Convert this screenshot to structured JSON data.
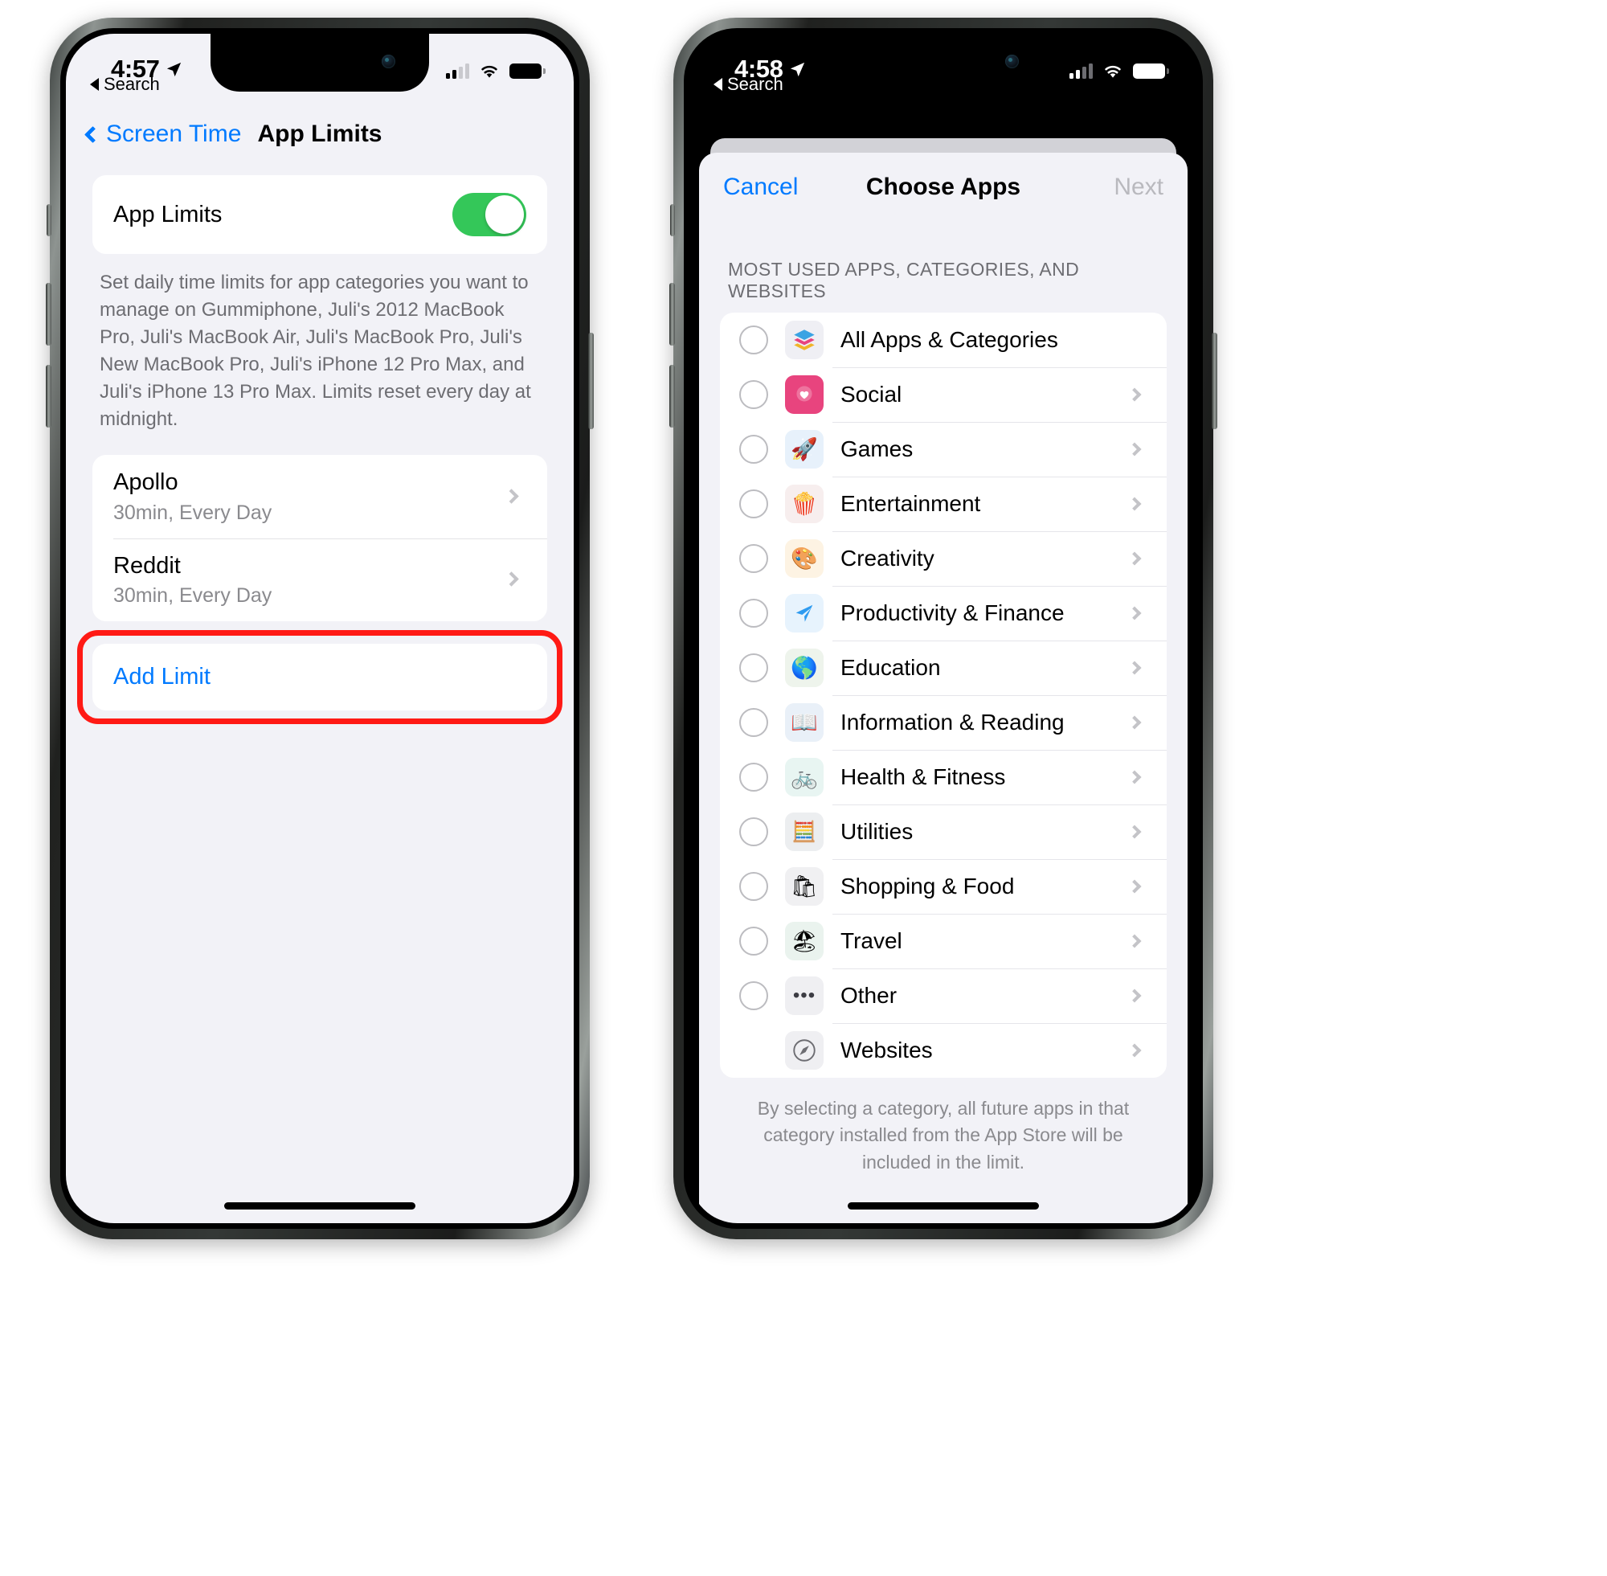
{
  "left_phone": {
    "status": {
      "time": "4:57",
      "location_icon": "location-arrow-icon",
      "signal_icon": "cellular-bars-icon",
      "wifi_icon": "wifi-icon",
      "battery_icon": "battery-full-icon"
    },
    "back_to_app": "Search",
    "nav": {
      "back_label": "Screen Time",
      "title": "App Limits"
    },
    "toggle_row": {
      "label": "App Limits",
      "state": "on",
      "accent_color": "#34c759"
    },
    "footnote": "Set daily time limits for app categories you want to manage on Gummiphone, Juli's 2012 MacBook Pro, Juli's MacBook Air, Juli's MacBook Pro, Juli's New MacBook Pro, Juli's iPhone 12 Pro Max, and Juli's iPhone 13 Pro Max. Limits reset every day at midnight.",
    "limits": [
      {
        "name": "Apollo",
        "detail": "30min, Every Day"
      },
      {
        "name": "Reddit",
        "detail": "30min, Every Day"
      }
    ],
    "add_limit": {
      "label": "Add Limit",
      "highlight_color": "#ff1a15",
      "text_color": "#007aff"
    }
  },
  "right_phone": {
    "status": {
      "time": "4:58",
      "location_icon": "location-arrow-icon",
      "signal_icon": "cellular-bars-icon",
      "wifi_icon": "wifi-icon",
      "battery_icon": "battery-full-icon"
    },
    "back_to_app": "Search",
    "sheet": {
      "cancel": "Cancel",
      "title": "Choose Apps",
      "next": "Next",
      "section_header": "MOST USED APPS, CATEGORIES, AND WEBSITES",
      "options": [
        {
          "label": "All Apps & Categories",
          "icon": "layers-icon",
          "glyph": "☰",
          "selected": false,
          "has_chevron": false,
          "has_radio": true
        },
        {
          "label": "Social",
          "icon": "social-heart-icon",
          "glyph": "♥",
          "selected": false,
          "has_chevron": true,
          "has_radio": true
        },
        {
          "label": "Games",
          "icon": "rocket-icon",
          "glyph": "🚀",
          "selected": false,
          "has_chevron": true,
          "has_radio": true
        },
        {
          "label": "Entertainment",
          "icon": "popcorn-icon",
          "glyph": "🍿",
          "selected": false,
          "has_chevron": true,
          "has_radio": true
        },
        {
          "label": "Creativity",
          "icon": "palette-icon",
          "glyph": "🎨",
          "selected": false,
          "has_chevron": true,
          "has_radio": true
        },
        {
          "label": "Productivity & Finance",
          "icon": "paper-plane-icon",
          "glyph": "➤",
          "selected": false,
          "has_chevron": true,
          "has_radio": true
        },
        {
          "label": "Education",
          "icon": "globe-icon",
          "glyph": "🌎",
          "selected": false,
          "has_chevron": true,
          "has_radio": true
        },
        {
          "label": "Information & Reading",
          "icon": "open-book-icon",
          "glyph": "📖",
          "selected": false,
          "has_chevron": true,
          "has_radio": true
        },
        {
          "label": "Health & Fitness",
          "icon": "bicycle-icon",
          "glyph": "🚲",
          "selected": false,
          "has_chevron": true,
          "has_radio": true
        },
        {
          "label": "Utilities",
          "icon": "calculator-icon",
          "glyph": "📟",
          "selected": false,
          "has_chevron": true,
          "has_radio": true
        },
        {
          "label": "Shopping & Food",
          "icon": "shopping-bag-icon",
          "glyph": "🛍",
          "selected": false,
          "has_chevron": true,
          "has_radio": true
        },
        {
          "label": "Travel",
          "icon": "beach-palm-icon",
          "glyph": "🏖",
          "selected": false,
          "has_chevron": true,
          "has_radio": true
        },
        {
          "label": "Other",
          "icon": "ellipsis-icon",
          "glyph": "•••",
          "selected": false,
          "has_chevron": true,
          "has_radio": true
        },
        {
          "label": "Websites",
          "icon": "safari-compass-icon",
          "glyph": "⦿",
          "selected": false,
          "has_chevron": true,
          "has_radio": false
        }
      ],
      "footer": "By selecting a category, all future apps in that category installed from the App Store will be included in the limit."
    }
  }
}
